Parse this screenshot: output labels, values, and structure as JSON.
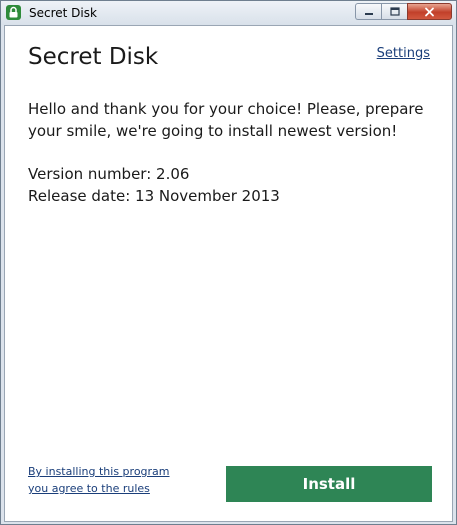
{
  "window": {
    "title": "Secret Disk",
    "icon": "lock-icon",
    "controls": [
      "minimize-icon",
      "maximize-icon",
      "close-icon"
    ]
  },
  "main": {
    "heading": "Secret Disk",
    "settings_link": "Settings",
    "welcome_text": "Hello and thank you for your choice! Please, prepare your smile, we're going to install newest version!",
    "version_line": "Version number: 2.06",
    "release_line": "Release date: 13 November 2013"
  },
  "footer": {
    "rules_link": "By installing this program you agree to the rules",
    "install_label": "Install"
  },
  "colors": {
    "accent": "#2e8555",
    "link": "#1a3e7a",
    "close_button": "#c2402a"
  }
}
